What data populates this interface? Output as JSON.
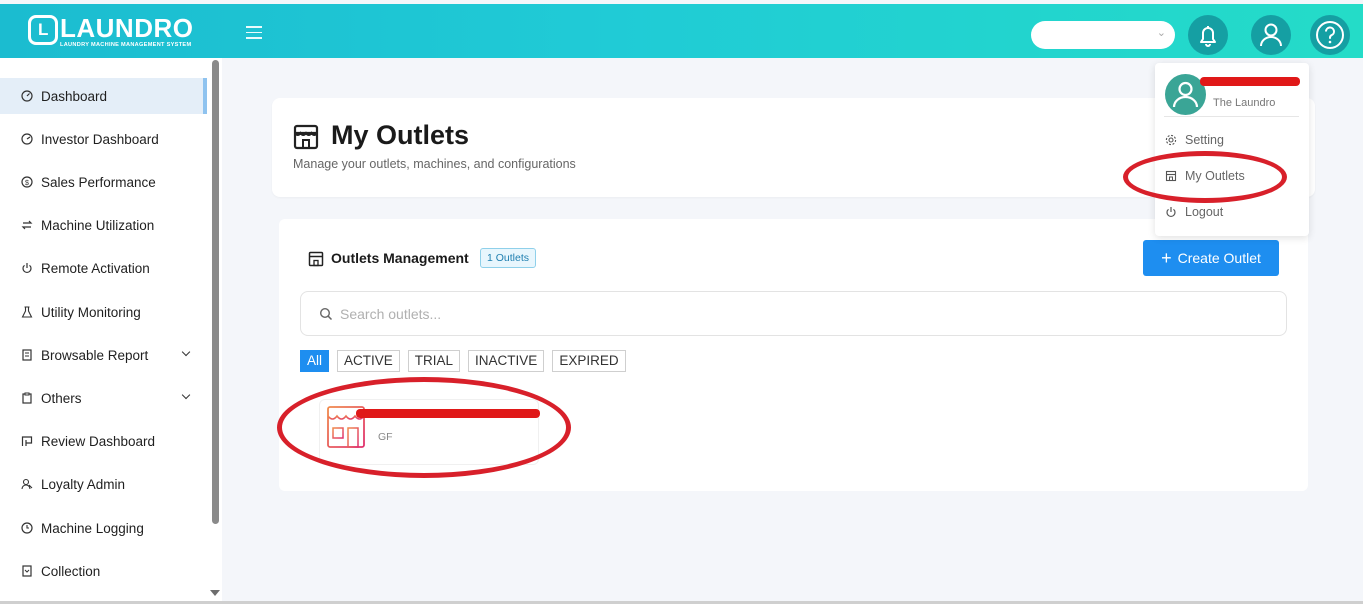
{
  "header": {
    "logo_word": "LAUNDRO",
    "logo_tagline": "LAUNDRY MACHINE MANAGEMENT SYSTEM",
    "menu_icon": "hamburger-icon",
    "select_value": "",
    "icons": [
      "bell-icon",
      "user-icon",
      "help-icon"
    ],
    "colors": {
      "gradient_start": "#1bbcd0",
      "gradient_end": "#24dcc8",
      "icon_circle": "#159fa3"
    }
  },
  "sidebar": {
    "items": [
      {
        "label": "Dashboard",
        "icon": "dashboard-icon",
        "active": true
      },
      {
        "label": "Investor Dashboard",
        "icon": "gauge-icon"
      },
      {
        "label": "Sales Performance",
        "icon": "dollar-icon"
      },
      {
        "label": "Machine Utilization",
        "icon": "exchange-icon"
      },
      {
        "label": "Remote Activation",
        "icon": "power-icon"
      },
      {
        "label": "Utility Monitoring",
        "icon": "flask-icon"
      },
      {
        "label": "Browsable Report",
        "icon": "report-icon",
        "expandable": true
      },
      {
        "label": "Others",
        "icon": "clipboard-icon",
        "expandable": true
      },
      {
        "label": "Review Dashboard",
        "icon": "review-icon"
      },
      {
        "label": "Loyalty Admin",
        "icon": "loyalty-icon"
      },
      {
        "label": "Machine Logging",
        "icon": "clock-icon"
      },
      {
        "label": "Collection",
        "icon": "collection-icon"
      }
    ]
  },
  "page": {
    "title": "My Outlets",
    "subtitle": "Manage your outlets, machines, and configurations"
  },
  "outlets_panel": {
    "title": "Outlets Management",
    "count_badge": "1 Outlets",
    "create_button": "Create Outlet",
    "search_placeholder": "Search outlets...",
    "filters": [
      "All",
      "ACTIVE",
      "TRIAL",
      "INACTIVE",
      "EXPIRED"
    ],
    "active_filter": "All",
    "outlets": [
      {
        "name": "",
        "code": "GF",
        "icon": "store-icon"
      }
    ]
  },
  "user_menu": {
    "user_name": "",
    "company": "The Laundro",
    "items": [
      {
        "label": "Setting",
        "icon": "gear-icon"
      },
      {
        "label": "My Outlets",
        "icon": "store-icon"
      },
      {
        "label": "Logout",
        "icon": "power-icon"
      }
    ]
  },
  "colors": {
    "primary": "#1e8ef0",
    "annotation_red": "#d8202a"
  }
}
